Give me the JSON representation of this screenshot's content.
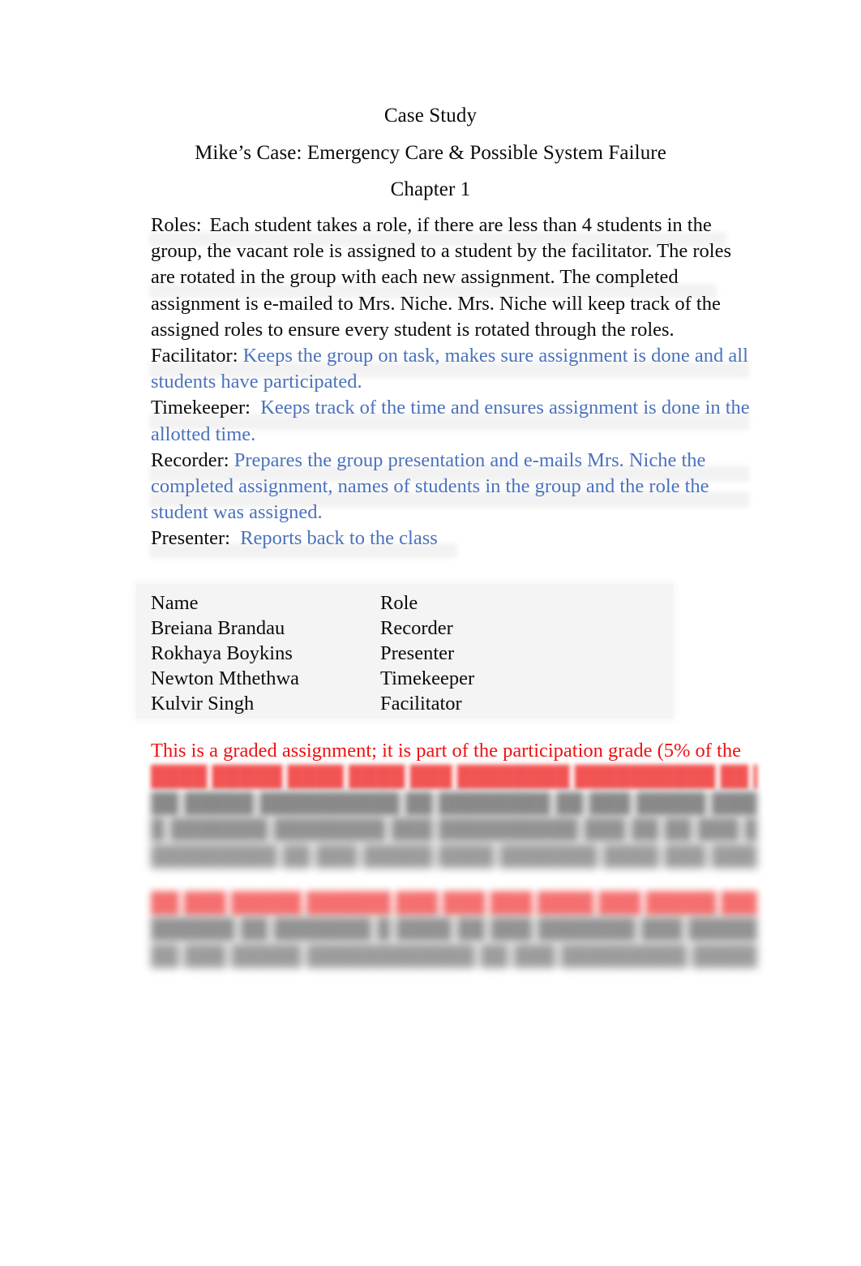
{
  "document": {
    "headings": [
      "Case Study",
      "Mike’s Case: Emergency Care & Possible System Failure",
      "Chapter 1"
    ],
    "roles_intro": {
      "label": "Roles:",
      "text": "Each student takes a role, if there are less than 4 students in the group, the vacant role is assigned to a student by the facilitator. The roles are rotated in the group with each new assignment. The completed assignment is e-mailed to Mrs. Niche. Mrs. Niche will keep track of the assigned roles to ensure every student is rotated through the roles."
    },
    "role_definitions": [
      {
        "label": "Facilitator:",
        "description": "Keeps the group on task, makes sure assignment is done and all students have participated."
      },
      {
        "label": "Timekeeper:",
        "description": "Keeps track of the time and ensures assignment is done in the allotted time."
      },
      {
        "label": "Recorder:",
        "description": "Prepares the group presentation and e-mails Mrs. Niche the completed assignment, names of students in the group and the role the student was assigned."
      },
      {
        "label": "Presenter:",
        "description": "Reports back to the class"
      }
    ],
    "roster_table": {
      "headers": [
        "Name",
        "Role"
      ],
      "rows": [
        [
          "Breiana Brandau",
          "Recorder"
        ],
        [
          "Rokhaya Boykins",
          "Presenter"
        ],
        [
          "Newton Mthethwa",
          "Timekeeper"
        ],
        [
          "Kulvir Singh",
          "Facilitator"
        ]
      ]
    },
    "notice": {
      "legible_line": "This is a graded assignment; it is part of the participation grade (5% of the",
      "illegible_lines": [
        "████ █████ ████ ████ ███ ████████ ██████████ ██ ████████",
        "██ █████ ██████████ ██ ████████ ██ ███ █████ ████ █ ███ ██████",
        "█ ███████ ████████ ███ ██████████ ███ ██ ██ ███ ████████ ████",
        "█████████ ██ ███ █████ ████ ███████ ████ ███ █████ █████"
      ],
      "illegible_lines_2": [
        "██ ███ █████ ██████ ███ ███ ███     ████ ███ █████ ███████ █ ███ ██ ███ ████",
        "██████    ██ ███████ █ ████ ██ ███ ███████ ███ ███████ ████ ███████ █ ████",
        "██ ███ █████ ████████████ ██ ███ █████████ ███████ ███ █████ ███ ███"
      ]
    },
    "colors": {
      "role_description_blue": "#4a72bd",
      "notice_red": "#ee1111",
      "table_background": "#f4f4f4",
      "page_background": "#ffffff",
      "text_black": "#0b0b0b"
    }
  }
}
